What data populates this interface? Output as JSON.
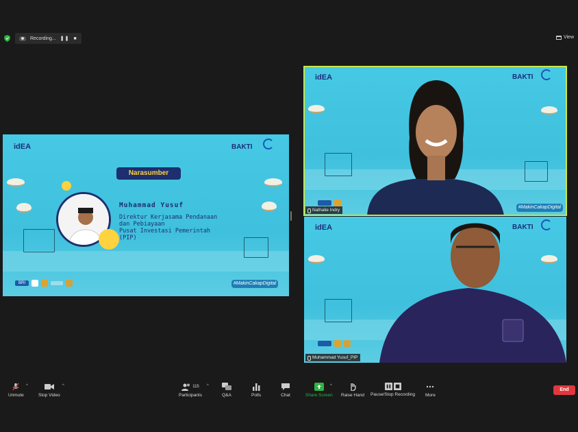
{
  "top_bar": {
    "recording_label": "Recording...",
    "pause_symbol": "❚❚",
    "stop_symbol": "■",
    "view_label": "View"
  },
  "presenter_slide": {
    "idea_logo": "idEA",
    "bakti_logo": "BAKTI",
    "kominfo_logo": "KOMINFO",
    "pill_caption": "Narasumber",
    "speaker_name": "Muhammad Yusuf",
    "speaker_title_lines": [
      "Direktur Kerjasama Pendanaan",
      "dan Pebiayaan",
      "Pusat Investasi Pemerintah",
      "(PIP)"
    ],
    "hashtag": "#MakinCakapDigital",
    "bri_logo": "BRI"
  },
  "participants": [
    {
      "name": "Nathalie Indry",
      "hashtag": "#MakinCakapDigital",
      "idea_logo": "idEA",
      "bakti_logo": "BAKTI",
      "kominfo_logo": "KOMINFO"
    },
    {
      "name": "Muhammad Yusuf_PIP",
      "idea_logo": "idEA",
      "bakti_logo": "BAKTI",
      "kominfo_logo": "KOMINFO"
    }
  ],
  "toolbar": {
    "unmute": "Unmute",
    "stop_video": "Stop Video",
    "participants": "Participants",
    "participants_count": "115",
    "qa": "Q&A",
    "polls": "Polls",
    "chat": "Chat",
    "share_screen": "Share Screen",
    "raise_hand": "Raise Hand",
    "pause_stop_recording": "Pause/Stop Recording",
    "more": "More",
    "end": "End",
    "caret": "^"
  },
  "colors": {
    "active_speaker_border": "#c9e84a",
    "share_green": "#2fb344",
    "end_red": "#e0383e",
    "slide_blue": "#3fc0dd",
    "navy": "#1d2f6e"
  }
}
